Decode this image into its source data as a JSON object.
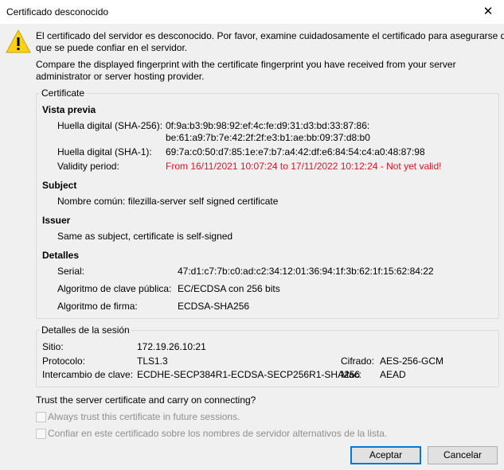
{
  "window": {
    "title": "Certificado desconocido"
  },
  "intro": {
    "line1": "El certificado del servidor es desconocido. Por favor, examine cuidadosamente el certificado para asegurarse de",
    "line2": "que se puede confiar en el servidor.",
    "compare1": "Compare the displayed fingerprint with the certificate fingerprint you have received from your server",
    "compare2": "administrator or server hosting provider."
  },
  "certificate": {
    "legend": "Certificate",
    "preview": {
      "heading": "Vista previa",
      "sha256_label": "Huella digital (SHA-256):",
      "sha256_line1": "0f:9a:b3:9b:98:92:ef:4c:fe:d9:31:d3:bd:33:87:86:",
      "sha256_line2": "be:61:a9:7b:7e:42:2f:2f:e3:b1:ae:bb:09:37:d8:b0",
      "sha1_label": "Huella digital (SHA-1):",
      "sha1_value": "69:7a:c0:50:d7:85:1e:e7:b7:a4:42:df:e6:84:54:c4:a0:48:87:98",
      "validity_label": "Validity period:",
      "validity_value": "From 16/11/2021 10:07:24 to 17/11/2022 10:12:24 - Not yet valid!"
    },
    "subject": {
      "heading": "Subject",
      "common_name": "Nombre común:  filezilla-server self signed certificate"
    },
    "issuer": {
      "heading": "Issuer",
      "text": "Same as subject, certificate is self-signed"
    },
    "details": {
      "heading": "Detalles",
      "serial_label": "Serial:",
      "serial_value": "47:d1:c7:7b:c0:ad:c2:34:12:01:36:94:1f:3b:62:1f:15:62:84:22",
      "pk_alg_label": "Algoritmo de clave pública:",
      "pk_alg_value": "EC/ECDSA con 256 bits",
      "sig_alg_label": "Algoritmo de firma:",
      "sig_alg_value": "ECDSA-SHA256"
    }
  },
  "session": {
    "legend": "Detalles de la sesión",
    "host_label": "Sitio:",
    "host_value": "172.19.26.10:21",
    "protocol_label": "Protocolo:",
    "protocol_value": "TLS1.3",
    "cipher_label": "Cifrado:",
    "cipher_value": "AES-256-GCM",
    "kex_label": "Intercambio de clave:",
    "kex_value": "ECDHE-SECP384R1-ECDSA-SECP256R1-SHA256",
    "mac_label": "Mac:",
    "mac_value": "AEAD"
  },
  "trust": {
    "question": "Trust the server certificate and carry on connecting?",
    "always_trust": "Always trust this certificate in future sessions.",
    "alt_names": "Confiar en este certificado sobre los nombres de servidor alternativos de la lista.",
    "always_trust_checked": false,
    "alt_names_checked": false
  },
  "buttons": {
    "accept": "Aceptar",
    "cancel": "Cancelar"
  },
  "icons": {
    "warning": "warning-icon",
    "close": "close-icon"
  },
  "colors": {
    "error": "#e81123",
    "focus": "#0078d7",
    "warning_fill": "#fcd116"
  }
}
